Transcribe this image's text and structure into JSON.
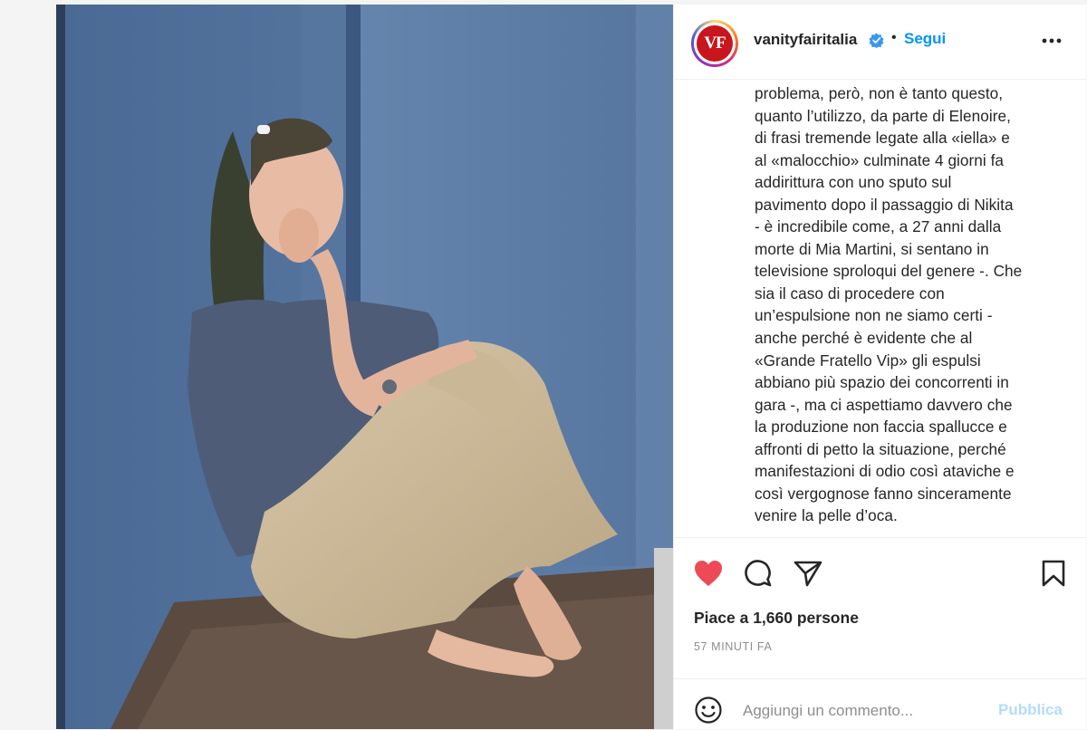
{
  "post": {
    "username": "vanityfairitalia",
    "avatar_text": "VF",
    "follow_label": "Segui",
    "separator": "•",
    "verified_icon": "verified-badge-icon",
    "more_icon": "more-options-icon"
  },
  "caption": {
    "lines": [
      "problema, però, non è tanto questo,",
      "quanto l’utilizzo, da parte di Elenoire,",
      "di frasi tremende legate alla «iella» e",
      "al «malocchio» culminate 4 giorni fa",
      "addirittura con uno sputo sul",
      "pavimento dopo il passaggio di Nikita",
      "- è incredibile come, a 27 anni dalla",
      "morte di Mia Martini, si sentano in",
      "televisione sproloqui del genere -. Che",
      "sia il caso di procedere con",
      "un’espulsione non ne siamo certi -",
      "anche perché è evidente che al",
      "«Grande Fratello Vip» gli espulsi",
      "abbiano più spazio dei concorrenti in",
      "gara -, ma ci aspettiamo davvero che",
      "la produzione non faccia spallucce e",
      "affronti di petto la situazione, perché",
      "manifestazioni di odio così ataviche e",
      "così vergognose fanno sinceramente",
      "venire la pelle d’oca."
    ]
  },
  "actions": {
    "like_icon": "heart-filled-icon",
    "comment_icon": "comment-icon",
    "share_icon": "share-icon",
    "save_icon": "bookmark-icon",
    "like_color": "#ed4956"
  },
  "stats": {
    "likes_text": "Piace a 1,660 persone",
    "time_text": "57 MINUTI FA"
  },
  "comment": {
    "placeholder": "Aggiungi un commento...",
    "publish_label": "Pubblica",
    "emoji_icon": "emoji-icon"
  },
  "colors": {
    "accent": "#0095f6",
    "publish_disabled": "#b3dbff",
    "wall": "#5b7ba3",
    "brand_red": "#c8161e"
  }
}
